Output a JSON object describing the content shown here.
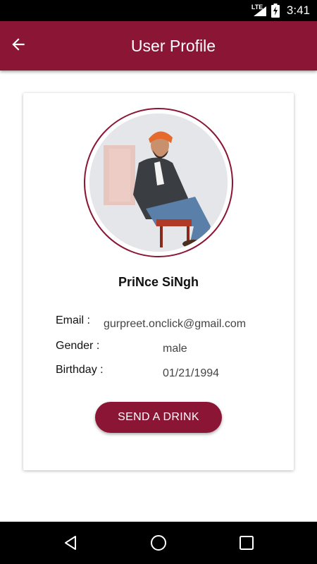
{
  "status_bar": {
    "network": "LTE",
    "time": "3:41"
  },
  "app_bar": {
    "title": "User Profile",
    "back_icon": "arrow-back-icon"
  },
  "profile": {
    "name": "PriNce SiNgh",
    "fields": [
      {
        "label": "Email :",
        "value": "gurpreet.onclick@gmail.com"
      },
      {
        "label": "Gender :",
        "value": "male"
      },
      {
        "label": "Birthday :",
        "value": "01/21/1994"
      }
    ],
    "action_label": "SEND A DRINK"
  },
  "nav_bar": {
    "buttons": [
      "back-triangle-icon",
      "home-circle-icon",
      "recents-square-icon"
    ]
  },
  "colors": {
    "primary": "#8b1535",
    "status_bar": "#000000",
    "nav_bar": "#000000",
    "card_bg": "#ffffff"
  }
}
